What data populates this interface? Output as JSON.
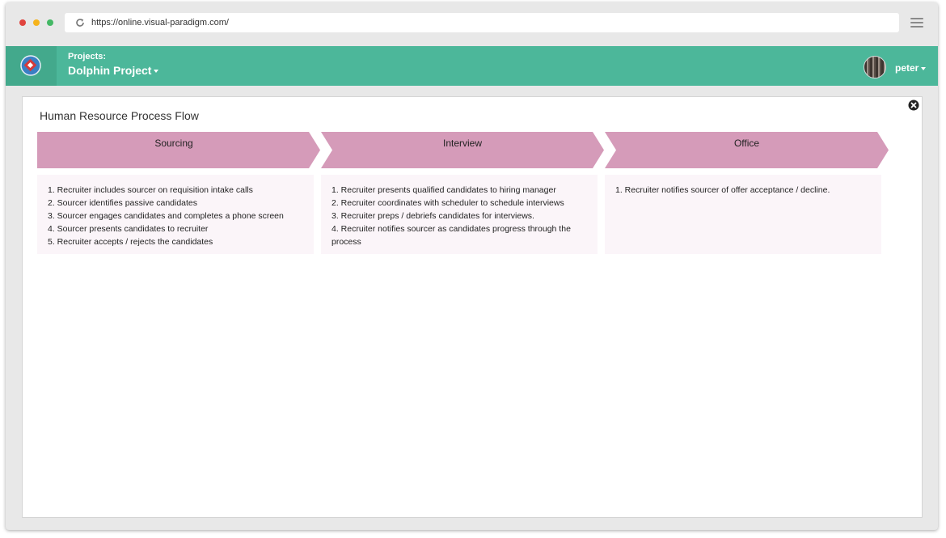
{
  "browser": {
    "url": "https://online.visual-paradigm.com/",
    "dots": [
      "#e0443e",
      "#f5b31c",
      "#44b865"
    ]
  },
  "header": {
    "projects_label": "Projects:",
    "project_name": "Dolphin Project",
    "username": "peter",
    "bg_color": "#4cb79a"
  },
  "diagram": {
    "title": "Human Resource Process Flow",
    "stage_color": "#d59bb9",
    "box_color": "#fbf5f9",
    "stages": [
      {
        "label": "Sourcing",
        "items": [
          "1. Recruiter includes sourcer on requisition intake calls",
          "2. Sourcer identifies passive candidates",
          "3. Sourcer engages candidates and completes a phone screen",
          "4. Sourcer presents candidates to recruiter",
          "5. Recruiter accepts / rejects the candidates"
        ]
      },
      {
        "label": "Interview",
        "items": [
          "1. Recruiter presents qualified candidates to hiring manager",
          "2. Recruiter coordinates with scheduler to schedule interviews",
          "3. Recruiter preps / debriefs candidates for interviews.",
          "4. Recruiter notifies sourcer as candidates progress through the process"
        ]
      },
      {
        "label": "Office",
        "items": [
          "1. Recruiter notifies sourcer of offer acceptance / decline."
        ]
      }
    ]
  }
}
